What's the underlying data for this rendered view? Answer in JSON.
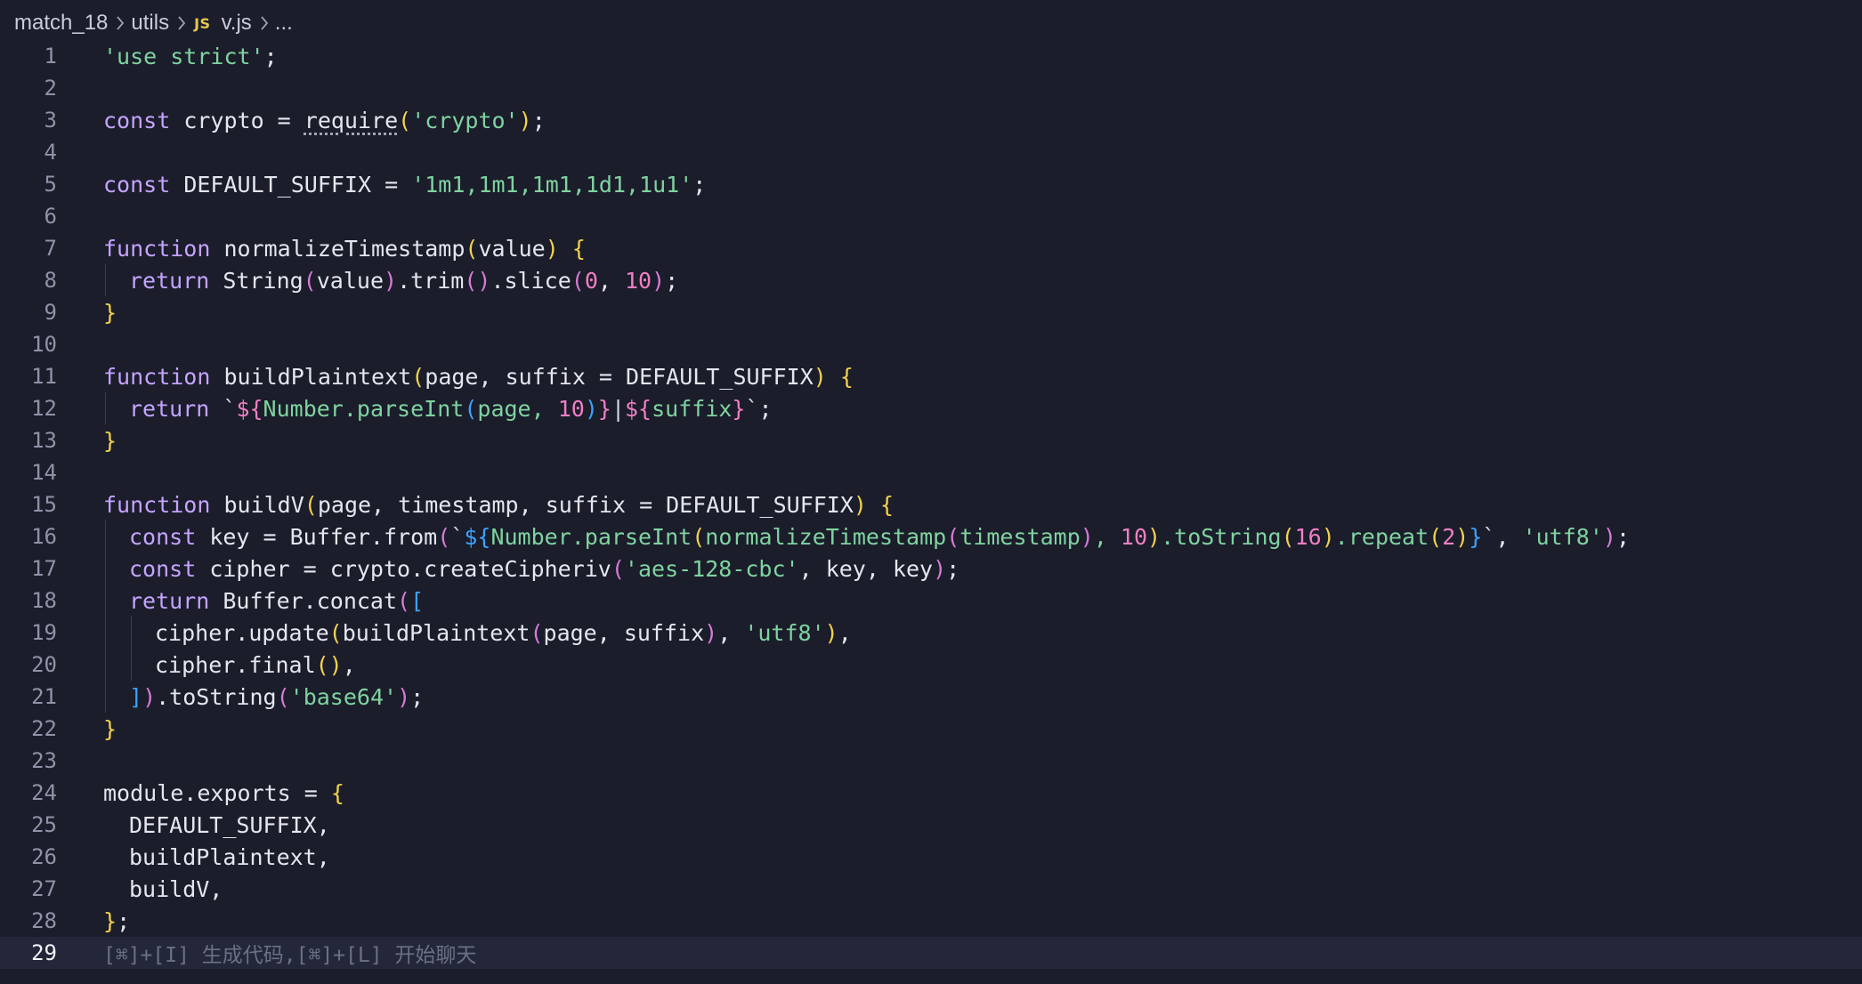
{
  "breadcrumb": {
    "folder1": "match_18",
    "folder2": "utils",
    "file_icon": "JS",
    "file": "v.js",
    "more": "..."
  },
  "editor": {
    "current_line": 29,
    "hint": "[⌘]+[I] 生成代码,[⌘]+[L] 开始聊天",
    "line_numbers": [
      "1",
      "2",
      "3",
      "4",
      "5",
      "6",
      "7",
      "8",
      "9",
      "10",
      "11",
      "12",
      "13",
      "14",
      "15",
      "16",
      "17",
      "18",
      "19",
      "20",
      "21",
      "22",
      "23",
      "24",
      "25",
      "26",
      "27",
      "28",
      "29"
    ]
  },
  "code": {
    "l1": [
      "'use strict'",
      ";"
    ],
    "l3": [
      "const",
      " crypto = ",
      "require",
      "(",
      "'crypto'",
      ")",
      ";"
    ],
    "l5": [
      "const",
      " DEFAULT_SUFFIX = ",
      "'1m1,1m1,1m1,1d1,1u1'",
      ";"
    ],
    "l7": [
      "function",
      " normalizeTimestamp",
      "(",
      "value",
      ")",
      " ",
      "{"
    ],
    "l8": [
      "return",
      " String",
      "(",
      "value",
      ")",
      ".trim",
      "()",
      ".slice",
      "(",
      "0",
      ", ",
      "10",
      ")",
      ";"
    ],
    "l9": [
      "}"
    ],
    "l11": [
      "function",
      " buildPlaintext",
      "(",
      "page, suffix = DEFAULT_SUFFIX",
      ")",
      " ",
      "{"
    ],
    "l12": [
      "return",
      " ",
      "`",
      "${",
      "Number.parseInt",
      "(",
      "page, ",
      "10",
      ")",
      "}",
      "|",
      "${",
      "suffix",
      "}",
      "`",
      ";"
    ],
    "l13": [
      "}"
    ],
    "l15": [
      "function",
      " buildV",
      "(",
      "page, timestamp, suffix = DEFAULT_SUFFIX",
      ")",
      " ",
      "{"
    ],
    "l16": [
      "const",
      " key = Buffer.from",
      "(",
      "`",
      "${",
      "Number.parseInt",
      "(",
      "normalizeTimestamp",
      "(",
      "timestamp",
      ")",
      ", ",
      "10",
      ")",
      ".toString",
      "(",
      "16",
      ")",
      ".repeat",
      "(",
      "2",
      ")",
      "}",
      "`",
      ", ",
      "'utf8'",
      ")",
      ";"
    ],
    "l17": [
      "const",
      " cipher = crypto.createCipheriv",
      "(",
      "'aes-128-cbc'",
      ", key, key",
      ")",
      ";"
    ],
    "l18": [
      "return",
      " Buffer.concat",
      "(",
      "["
    ],
    "l19": [
      "cipher.update",
      "(",
      "buildPlaintext",
      "(",
      "page, suffix",
      ")",
      ", ",
      "'utf8'",
      ")",
      ","
    ],
    "l20": [
      "cipher.final",
      "()",
      ","
    ],
    "l21": [
      "]",
      ")",
      ".toString",
      "(",
      "'base64'",
      ")",
      ";"
    ],
    "l22": [
      "}"
    ],
    "l24": [
      "module.exports = ",
      "{"
    ],
    "l25": [
      "DEFAULT_SUFFIX,"
    ],
    "l26": [
      "buildPlaintext,"
    ],
    "l27": [
      "buildV,"
    ],
    "l28": [
      "}",
      ";"
    ]
  },
  "colors": {
    "background": "#1b1d2b",
    "keyword": "#c5a3ff",
    "string": "#7fd3a0",
    "number": "#f07fc4",
    "bracket_yellow": "#f3d24c",
    "bracket_pink": "#d67bd8",
    "bracket_blue": "#3ba2ff",
    "line_number": "#8e93a8"
  }
}
